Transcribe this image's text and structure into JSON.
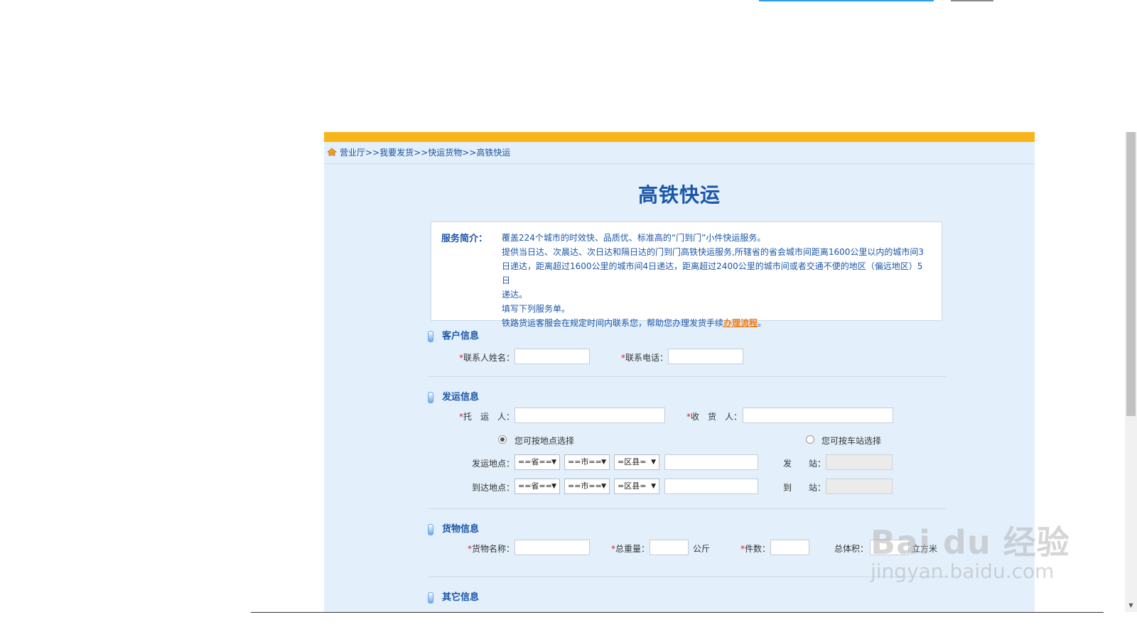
{
  "breadcrumb": "营业厅>>我要发货>>快运货物>>高铁快运",
  "title": "高铁快运",
  "intro": {
    "label": "服务简介：",
    "lines": [
      "覆盖224个城市的时效快、品质优、标准高的“门到门”小件快运服务。",
      "提供当日达、次晨达、次日达和隔日达的门到门高铁快运服务,所辖省的省会城市间距离1600公里以内的城市间3",
      "日递达，距离超过1600公里的城市间4日递达，距离超过2400公里的城市间或者交通不便的地区（偏远地区）5日",
      "递达。",
      "填写下列服务单。"
    ],
    "last_line_prefix": "铁路货运客服会在规定时间内联系您，帮助您办理发货手续",
    "link": "办理流程",
    "last_line_suffix": "。"
  },
  "customer": {
    "heading": "客户信息",
    "name_label": "联系人姓名：",
    "phone_label": "联系电话："
  },
  "shipping": {
    "heading": "发运信息",
    "shipper_label": "托　运　人：",
    "receiver_label": "收　货　人：",
    "radio_location": "您可按地点选择",
    "radio_station": "您可按车站选择",
    "from_label": "发运地点：",
    "to_label": "到达地点：",
    "province": "==省==",
    "city": "==市==",
    "county": "=区县=",
    "from_station_label": "发　　站：",
    "to_station_label": "到　　站："
  },
  "cargo": {
    "heading": "货物信息",
    "name_label": "货物名称：",
    "weight_label": "总重量：",
    "weight_unit": "公斤",
    "count_label": "件数：",
    "volume_label": "总体积：",
    "volume_unit": "立方米"
  },
  "other": {
    "heading": "其它信息"
  },
  "required_mark": "*",
  "watermark": {
    "main": "Bai du 经验",
    "sub": "jingyan.baidu.com"
  }
}
